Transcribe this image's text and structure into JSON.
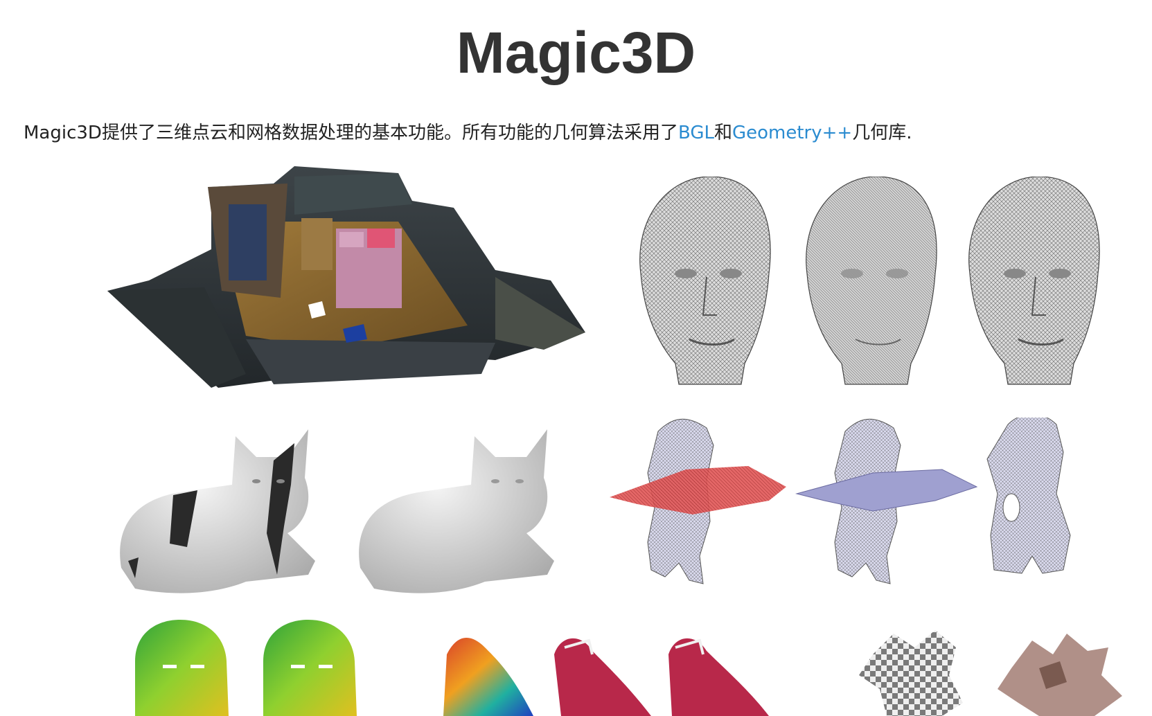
{
  "page": {
    "title": "Magic3D",
    "intro": {
      "text_before": "Magic3D提供了三维点云和网格数据处理的基本功能。所有功能的几何算法采用了",
      "link1": "BGL",
      "text_between": "和",
      "link2": "Geometry++",
      "text_after": "几何库."
    }
  },
  "colors": {
    "title": "#333333",
    "text": "#222222",
    "link": "#2a8bd0",
    "background": "#ffffff"
  },
  "figures": [
    {
      "name": "room-point-cloud-figure",
      "icon": "bedroom-scan-image"
    },
    {
      "name": "head-mesh-figure",
      "icon": "wireframe-heads-image"
    },
    {
      "name": "cat-model-figure",
      "icon": "cat-models-image"
    },
    {
      "name": "torso-mesh-figure",
      "icon": "torso-meshes-image"
    },
    {
      "name": "face-scan-figure",
      "icon": "colored-face-scans-image"
    },
    {
      "name": "shoe-model-figure",
      "icon": "shoe-models-image"
    },
    {
      "name": "monkey-param-figure",
      "icon": "checker-monkey-image"
    }
  ]
}
